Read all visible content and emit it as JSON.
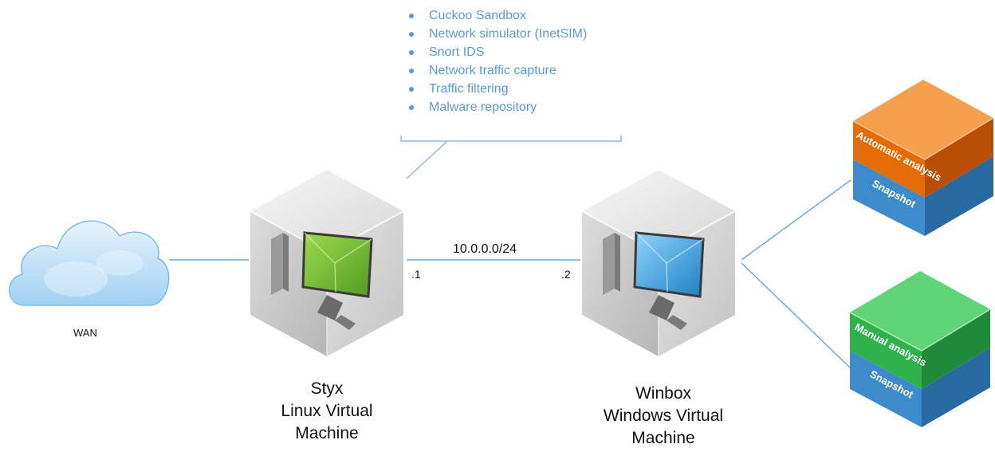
{
  "features": [
    "Cuckoo Sandbox",
    "Network simulator (InetSIM)",
    "Snort IDS",
    "Network traffic capture",
    "Traffic filtering",
    "Malware repository"
  ],
  "wan": {
    "label": "WAN"
  },
  "network": {
    "label": "10.0.0.0/24",
    "styx_ip": ".1",
    "winbox_ip": ".2"
  },
  "styx": {
    "name": "Styx",
    "desc_line1": "Linux Virtual",
    "desc_line2": "Machine"
  },
  "winbox": {
    "name": "Winbox",
    "desc_line1": "Windows Virtual",
    "desc_line2": "Machine"
  },
  "auto_stack": {
    "top_label": "Automatic analysis",
    "bottom_label": "Snapshot",
    "top_color": "#e36c0a",
    "bottom_color": "#3b87c6"
  },
  "manual_stack": {
    "top_label": "Manual analysis",
    "bottom_label": "Snapshot",
    "top_color": "#2fb24b",
    "bottom_color": "#3b87c6"
  },
  "colors": {
    "accent": "#5b9bd5",
    "styx_screen": "#7cc23a",
    "winbox_screen": "#2f9ed8"
  }
}
